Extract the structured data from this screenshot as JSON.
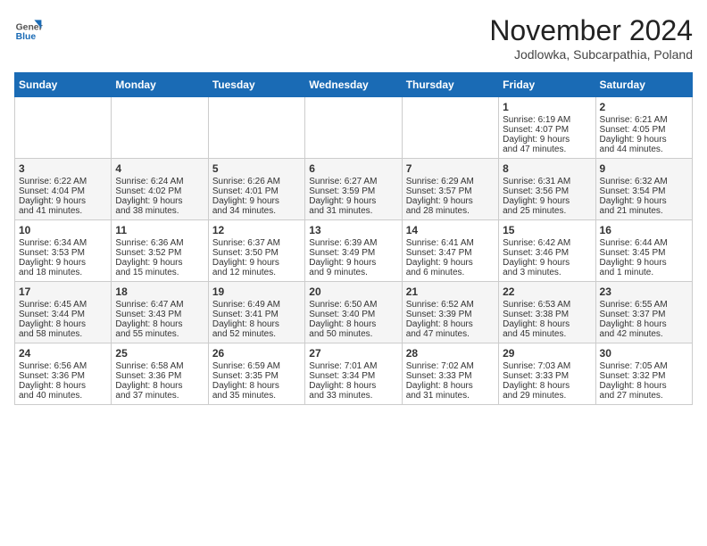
{
  "header": {
    "logo_general": "General",
    "logo_blue": "Blue",
    "month_title": "November 2024",
    "subtitle": "Jodlowka, Subcarpathia, Poland"
  },
  "days_of_week": [
    "Sunday",
    "Monday",
    "Tuesday",
    "Wednesday",
    "Thursday",
    "Friday",
    "Saturday"
  ],
  "weeks": [
    [
      {
        "day": "",
        "lines": []
      },
      {
        "day": "",
        "lines": []
      },
      {
        "day": "",
        "lines": []
      },
      {
        "day": "",
        "lines": []
      },
      {
        "day": "",
        "lines": []
      },
      {
        "day": "1",
        "lines": [
          "Sunrise: 6:19 AM",
          "Sunset: 4:07 PM",
          "Daylight: 9 hours",
          "and 47 minutes."
        ]
      },
      {
        "day": "2",
        "lines": [
          "Sunrise: 6:21 AM",
          "Sunset: 4:05 PM",
          "Daylight: 9 hours",
          "and 44 minutes."
        ]
      }
    ],
    [
      {
        "day": "3",
        "lines": [
          "Sunrise: 6:22 AM",
          "Sunset: 4:04 PM",
          "Daylight: 9 hours",
          "and 41 minutes."
        ]
      },
      {
        "day": "4",
        "lines": [
          "Sunrise: 6:24 AM",
          "Sunset: 4:02 PM",
          "Daylight: 9 hours",
          "and 38 minutes."
        ]
      },
      {
        "day": "5",
        "lines": [
          "Sunrise: 6:26 AM",
          "Sunset: 4:01 PM",
          "Daylight: 9 hours",
          "and 34 minutes."
        ]
      },
      {
        "day": "6",
        "lines": [
          "Sunrise: 6:27 AM",
          "Sunset: 3:59 PM",
          "Daylight: 9 hours",
          "and 31 minutes."
        ]
      },
      {
        "day": "7",
        "lines": [
          "Sunrise: 6:29 AM",
          "Sunset: 3:57 PM",
          "Daylight: 9 hours",
          "and 28 minutes."
        ]
      },
      {
        "day": "8",
        "lines": [
          "Sunrise: 6:31 AM",
          "Sunset: 3:56 PM",
          "Daylight: 9 hours",
          "and 25 minutes."
        ]
      },
      {
        "day": "9",
        "lines": [
          "Sunrise: 6:32 AM",
          "Sunset: 3:54 PM",
          "Daylight: 9 hours",
          "and 21 minutes."
        ]
      }
    ],
    [
      {
        "day": "10",
        "lines": [
          "Sunrise: 6:34 AM",
          "Sunset: 3:53 PM",
          "Daylight: 9 hours",
          "and 18 minutes."
        ]
      },
      {
        "day": "11",
        "lines": [
          "Sunrise: 6:36 AM",
          "Sunset: 3:52 PM",
          "Daylight: 9 hours",
          "and 15 minutes."
        ]
      },
      {
        "day": "12",
        "lines": [
          "Sunrise: 6:37 AM",
          "Sunset: 3:50 PM",
          "Daylight: 9 hours",
          "and 12 minutes."
        ]
      },
      {
        "day": "13",
        "lines": [
          "Sunrise: 6:39 AM",
          "Sunset: 3:49 PM",
          "Daylight: 9 hours",
          "and 9 minutes."
        ]
      },
      {
        "day": "14",
        "lines": [
          "Sunrise: 6:41 AM",
          "Sunset: 3:47 PM",
          "Daylight: 9 hours",
          "and 6 minutes."
        ]
      },
      {
        "day": "15",
        "lines": [
          "Sunrise: 6:42 AM",
          "Sunset: 3:46 PM",
          "Daylight: 9 hours",
          "and 3 minutes."
        ]
      },
      {
        "day": "16",
        "lines": [
          "Sunrise: 6:44 AM",
          "Sunset: 3:45 PM",
          "Daylight: 9 hours",
          "and 1 minute."
        ]
      }
    ],
    [
      {
        "day": "17",
        "lines": [
          "Sunrise: 6:45 AM",
          "Sunset: 3:44 PM",
          "Daylight: 8 hours",
          "and 58 minutes."
        ]
      },
      {
        "day": "18",
        "lines": [
          "Sunrise: 6:47 AM",
          "Sunset: 3:43 PM",
          "Daylight: 8 hours",
          "and 55 minutes."
        ]
      },
      {
        "day": "19",
        "lines": [
          "Sunrise: 6:49 AM",
          "Sunset: 3:41 PM",
          "Daylight: 8 hours",
          "and 52 minutes."
        ]
      },
      {
        "day": "20",
        "lines": [
          "Sunrise: 6:50 AM",
          "Sunset: 3:40 PM",
          "Daylight: 8 hours",
          "and 50 minutes."
        ]
      },
      {
        "day": "21",
        "lines": [
          "Sunrise: 6:52 AM",
          "Sunset: 3:39 PM",
          "Daylight: 8 hours",
          "and 47 minutes."
        ]
      },
      {
        "day": "22",
        "lines": [
          "Sunrise: 6:53 AM",
          "Sunset: 3:38 PM",
          "Daylight: 8 hours",
          "and 45 minutes."
        ]
      },
      {
        "day": "23",
        "lines": [
          "Sunrise: 6:55 AM",
          "Sunset: 3:37 PM",
          "Daylight: 8 hours",
          "and 42 minutes."
        ]
      }
    ],
    [
      {
        "day": "24",
        "lines": [
          "Sunrise: 6:56 AM",
          "Sunset: 3:36 PM",
          "Daylight: 8 hours",
          "and 40 minutes."
        ]
      },
      {
        "day": "25",
        "lines": [
          "Sunrise: 6:58 AM",
          "Sunset: 3:36 PM",
          "Daylight: 8 hours",
          "and 37 minutes."
        ]
      },
      {
        "day": "26",
        "lines": [
          "Sunrise: 6:59 AM",
          "Sunset: 3:35 PM",
          "Daylight: 8 hours",
          "and 35 minutes."
        ]
      },
      {
        "day": "27",
        "lines": [
          "Sunrise: 7:01 AM",
          "Sunset: 3:34 PM",
          "Daylight: 8 hours",
          "and 33 minutes."
        ]
      },
      {
        "day": "28",
        "lines": [
          "Sunrise: 7:02 AM",
          "Sunset: 3:33 PM",
          "Daylight: 8 hours",
          "and 31 minutes."
        ]
      },
      {
        "day": "29",
        "lines": [
          "Sunrise: 7:03 AM",
          "Sunset: 3:33 PM",
          "Daylight: 8 hours",
          "and 29 minutes."
        ]
      },
      {
        "day": "30",
        "lines": [
          "Sunrise: 7:05 AM",
          "Sunset: 3:32 PM",
          "Daylight: 8 hours",
          "and 27 minutes."
        ]
      }
    ]
  ]
}
